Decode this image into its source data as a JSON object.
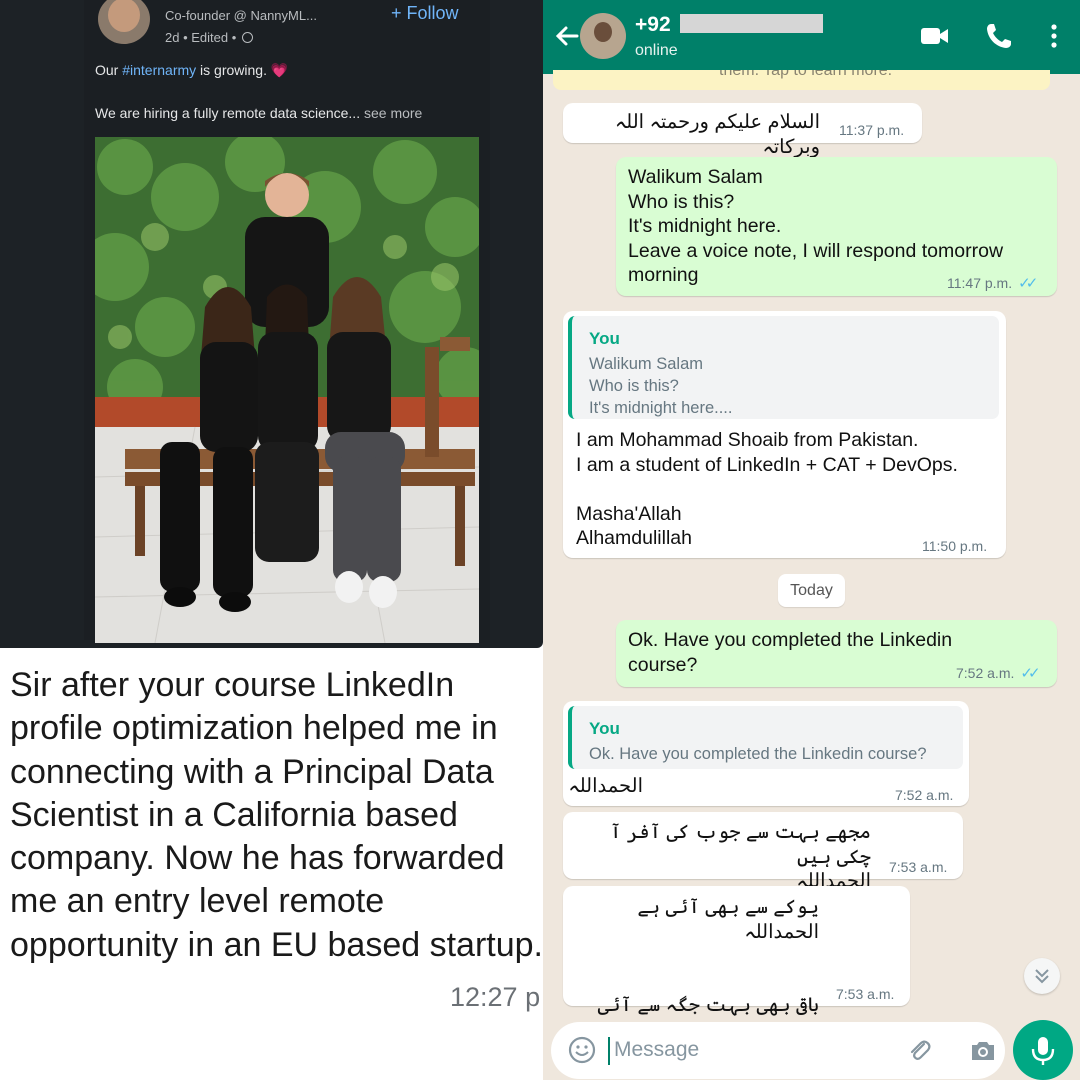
{
  "linkedin": {
    "author_subtitle": "Co-founder @ NannyML...",
    "meta": "2d • Edited •",
    "follow_label": "+ Follow",
    "post_line1_prefix": "Our ",
    "post_hashtag": "#internarmy",
    "post_line1_suffix": " is growing. 💗",
    "post_line2": "We are hiring a fully remote data science...",
    "see_more": " see more"
  },
  "left_message": {
    "text": "Sir after your course LinkedIn profile optimization helped me in connecting with a Principal Data Scientist in a California based company. Now he has forwarded me an entry level remote opportunity in an EU based startup.",
    "time": "12:27 p"
  },
  "whatsapp": {
    "contact_name": "+92",
    "status": "online",
    "banner_text": "them. Tap to learn more.",
    "day_chip": "Today",
    "input_placeholder": "Message",
    "messages": [
      {
        "dir": "in",
        "text": "السلام علیکم ورحمتہ اللہ وبرکاتہ",
        "time": "11:37 p.m."
      },
      {
        "dir": "out",
        "text": "Walikum Salam\nWho is this?\nIt's midnight here.\nLeave a voice note, I will respond tomorrow morning",
        "time": "11:47 p.m."
      },
      {
        "dir": "in",
        "quote_author": "You",
        "quote_text": "Walikum Salam\nWho is this?\nIt's midnight here....",
        "text": "I am Mohammad Shoaib from Pakistan.\nI am a student of LinkedIn + CAT + DevOps.\n\nMasha'Allah\nAlhamdulillah",
        "time": "11:50 p.m."
      },
      {
        "dir": "out",
        "text": "Ok. Have you completed the Linkedin course?",
        "time": "7:52 a.m."
      },
      {
        "dir": "in",
        "quote_author": "You",
        "quote_text": "Ok. Have you completed the Linkedin course?",
        "text": "الحمداللہ",
        "time": "7:52 a.m."
      },
      {
        "dir": "in",
        "text": "مجھے بہت سے جوب کی آفر آ چکی ہیں\nالحمداللہ",
        "time": "7:53 a.m."
      },
      {
        "dir": "in",
        "text": "یوکے سے بھی آئی ہے\nالحمداللہ\n\n\nباقی بھی بہت جگہ سے آئی ہیں۔",
        "time": "7:53 a.m."
      }
    ]
  },
  "colors": {
    "wa_header": "#008069",
    "wa_outgoing": "#d9fdd3",
    "wa_incoming": "#ffffff",
    "wa_background": "#efe7dd",
    "read_tick": "#53bdeb",
    "linkedin_dark": "#1b1f23",
    "linkedin_link": "#70b5f9"
  }
}
